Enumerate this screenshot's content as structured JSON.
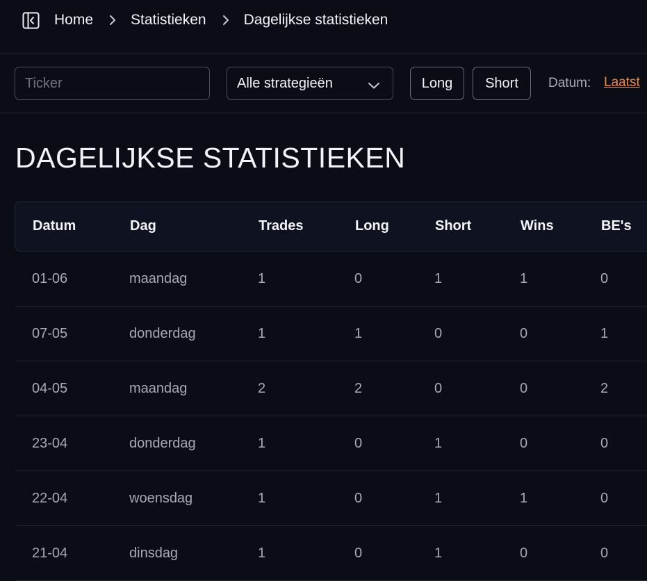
{
  "breadcrumb": {
    "items": [
      "Home",
      "Statistieken",
      "Dagelijkse statistieken"
    ]
  },
  "filters": {
    "search_placeholder": "Ticker",
    "search_value": "",
    "strategy_selected": "Alle strategieën",
    "long_label": "Long",
    "short_label": "Short",
    "date_label": "Datum:",
    "date_value": "Laatst"
  },
  "page": {
    "title": "DAGELIJKSE STATISTIEKEN"
  },
  "table": {
    "columns": [
      "Datum",
      "Dag",
      "Trades",
      "Long",
      "Short",
      "Wins",
      "BE's"
    ],
    "rows": [
      [
        "01-06",
        "maandag",
        "1",
        "0",
        "1",
        "1",
        "0"
      ],
      [
        "07-05",
        "donderdag",
        "1",
        "1",
        "0",
        "0",
        "1"
      ],
      [
        "04-05",
        "maandag",
        "2",
        "2",
        "0",
        "0",
        "2"
      ],
      [
        "23-04",
        "donderdag",
        "1",
        "0",
        "1",
        "0",
        "0"
      ],
      [
        "22-04",
        "woensdag",
        "1",
        "0",
        "1",
        "1",
        "0"
      ],
      [
        "21-04",
        "dinsdag",
        "1",
        "0",
        "1",
        "0",
        "0"
      ]
    ]
  },
  "colors": {
    "background": "#0b0d16",
    "accent_link": "#f08a3c",
    "border": "#23262f"
  }
}
